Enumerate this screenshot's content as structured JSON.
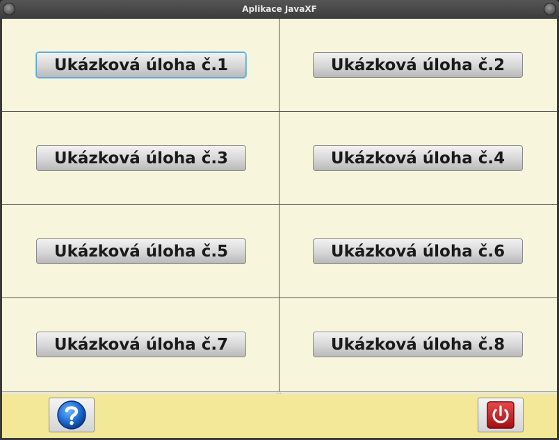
{
  "window": {
    "title": "Aplikace JavaXF"
  },
  "tasks": [
    {
      "label": "Ukázková úloha č.1"
    },
    {
      "label": "Ukázková úloha č.2"
    },
    {
      "label": "Ukázková úloha č.3"
    },
    {
      "label": "Ukázková úloha č.4"
    },
    {
      "label": "Ukázková úloha č.5"
    },
    {
      "label": "Ukázková úloha č.6"
    },
    {
      "label": "Ukázková úloha č.7"
    },
    {
      "label": "Ukázková úloha č.8"
    }
  ],
  "focused_task": 1,
  "toolbar": {
    "help_icon": "help-icon",
    "power_icon": "power-icon"
  },
  "colors": {
    "content_bg": "#f7f6dc",
    "toolbar_bg": "#f2e898",
    "focus_ring": "#5aa7dc",
    "help_blue": "#1f6fd6",
    "power_red": "#c8191e"
  }
}
